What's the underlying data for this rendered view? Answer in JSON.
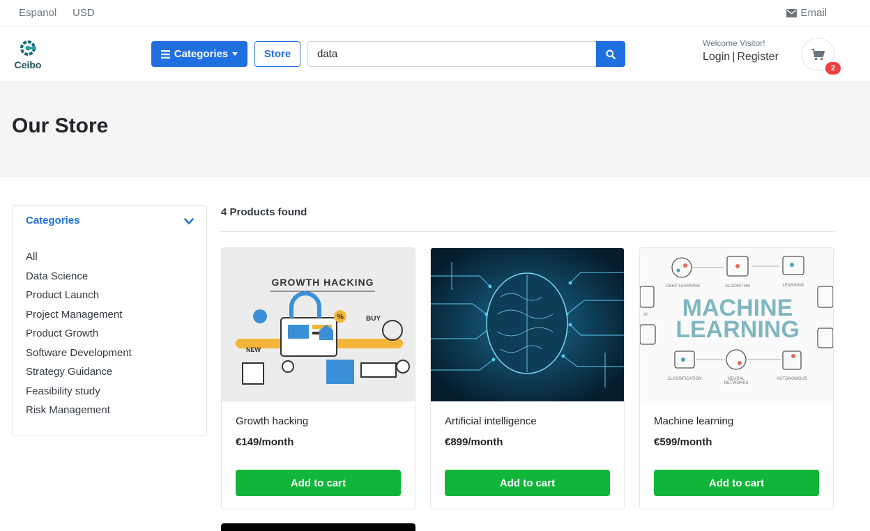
{
  "topbar": {
    "language": "Espanol",
    "currency": "USD",
    "email_label": "Email"
  },
  "header": {
    "logo_text": "Ceibo",
    "categories_label": "Categories",
    "store_label": "Store",
    "search_value": "data",
    "welcome": "Welcome Visitor!",
    "login_label": "Login",
    "register_label": "Register",
    "cart_count": "2"
  },
  "hero": {
    "title": "Our Store"
  },
  "sidebar": {
    "heading": "Categories",
    "items": [
      "All",
      "Data Science",
      "Product Launch",
      "Project Management",
      "Product Growth",
      "Software Development",
      "Strategy Guidance",
      "Feasibility study",
      "Risk Management"
    ]
  },
  "products": {
    "found_label": "4 Products found",
    "items": [
      {
        "name": "Growth hacking",
        "price": "€149/month",
        "button": "Add to cart",
        "image_text": "GROWTH HACKING"
      },
      {
        "name": "Artificial intelligence",
        "price": "€899/month",
        "button": "Add to cart"
      },
      {
        "name": "Machine learning",
        "price": "€599/month",
        "button": "Add to cart",
        "image_text_1": "MACHINE",
        "image_text_2": "LEARNING"
      }
    ]
  },
  "colors": {
    "primary": "#1f6fe0",
    "success": "#11b53a",
    "badge": "#f03e3e",
    "hero_bg": "#f5f5f6"
  }
}
